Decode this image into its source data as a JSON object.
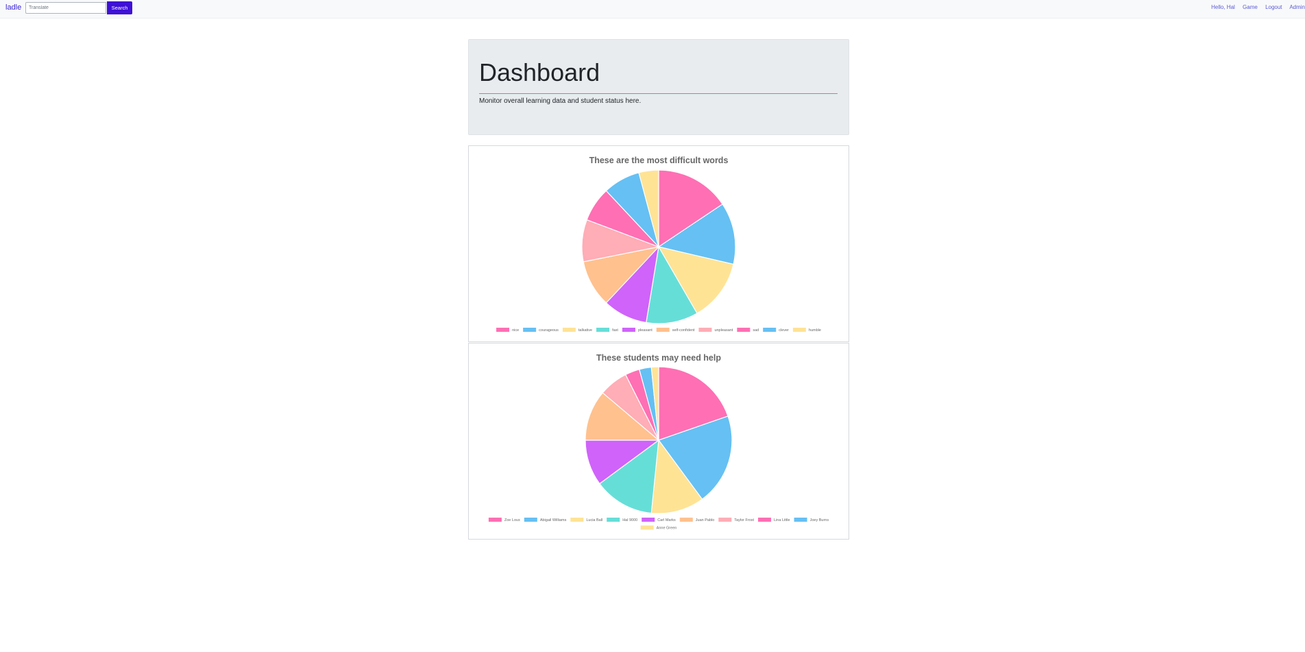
{
  "navbar": {
    "brand": "ladle",
    "search": {
      "placeholder": "Translate",
      "button_label": "Search"
    },
    "links": [
      "Hello, Hal",
      "Game",
      "Logout",
      "Admin"
    ]
  },
  "jumbotron": {
    "title": "Dashboard",
    "subtitle": "Monitor overall learning data and student status here."
  },
  "palette": [
    "#ff6fb4",
    "#66c0f3",
    "#ffe395",
    "#66ded8",
    "#d063fa",
    "#ffc18e",
    "#ffadb6"
  ],
  "chart_data": [
    {
      "type": "pie",
      "title": "These are the most difficult words",
      "legend_position": "bottom",
      "categories": [
        "nice",
        "courageous",
        "talkative",
        "fast",
        "pleasant",
        "self-confident",
        "unpleasant",
        "sad",
        "clever",
        "humble"
      ],
      "values": [
        15,
        12.5,
        12.5,
        10.5,
        9,
        9.5,
        8.5,
        7,
        7.5,
        4
      ]
    },
    {
      "type": "pie",
      "title": "These students may need help",
      "legend_position": "bottom",
      "categories": [
        "Zoe Loux",
        "Abigail Williams",
        "Lucia Ball",
        "Hal 9000",
        "Carl Marks",
        "Juan Pablo",
        "Taylor Frost",
        "Lina Little",
        "Joey Burns",
        "Anne Green"
      ],
      "values": [
        18.5,
        19,
        11,
        12.5,
        9.5,
        10.5,
        6,
        3,
        2.5,
        1.5
      ]
    }
  ]
}
